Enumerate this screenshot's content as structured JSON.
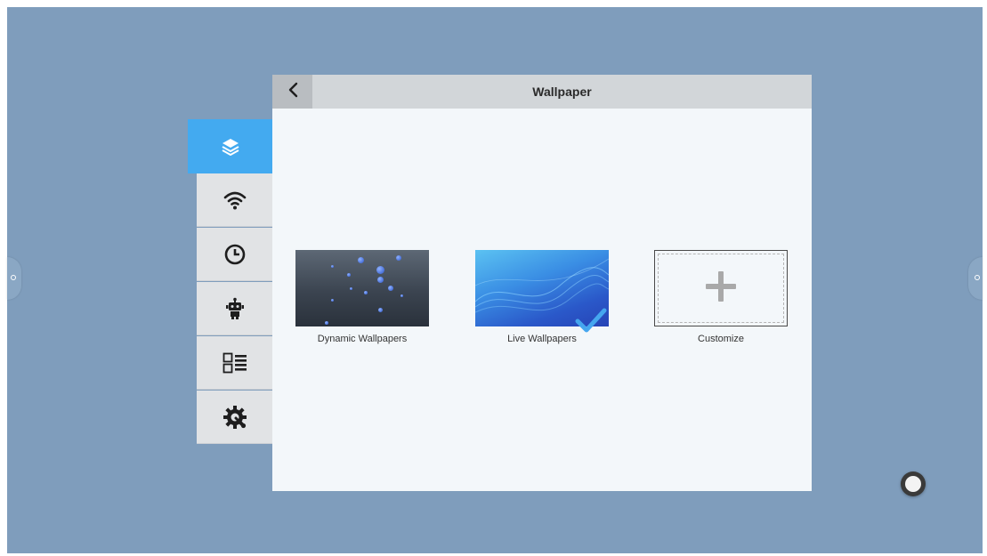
{
  "panel": {
    "title": "Wallpaper"
  },
  "sidebar": {
    "items": [
      {
        "icon": "layers-icon",
        "active": true
      },
      {
        "icon": "wifi-icon",
        "active": false
      },
      {
        "icon": "clock-icon",
        "active": false
      },
      {
        "icon": "robot-icon",
        "active": false
      },
      {
        "icon": "list-layout-icon",
        "active": false
      },
      {
        "icon": "gear-wrench-icon",
        "active": false
      }
    ]
  },
  "wallpapers": [
    {
      "label": "Dynamic Wallpapers",
      "selected": false
    },
    {
      "label": "Live Wallpapers",
      "selected": true
    },
    {
      "label": "Customize",
      "selected": false
    }
  ],
  "colors": {
    "desktop_bg": "#7f9dbc",
    "sidebar_active": "#43aaf0",
    "sidebar_item": "#e1e3e5",
    "panel_bg": "#f3f7fa",
    "header_bg": "#d2d6d9",
    "check": "#45a6ef"
  }
}
